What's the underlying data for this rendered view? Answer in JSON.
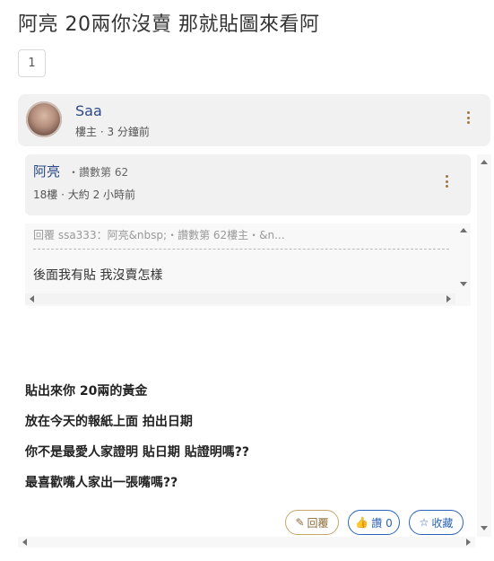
{
  "thread": {
    "title": "阿亮 20兩你沒賣 那就貼圖來看阿",
    "page": "1"
  },
  "op": {
    "name": "Saa",
    "role": "樓主",
    "time": "3 分鐘前"
  },
  "reply": {
    "name": "阿亮",
    "sub": "・讚數第 62",
    "floor": "18樓",
    "time": "大約 2 小時前",
    "quote_ref": "回覆 ssa333：阿亮&nbsp;・讚數第 62樓主・&n...",
    "quote_body": "後面我有貼 我沒賣怎樣",
    "body": [
      "貼出來你 20兩的黃金",
      "放在今天的報紙上面 拍出日期",
      "你不是最愛人家證明 貼日期 貼證明嗎??",
      "最喜歡嘴人家出一張嘴嗎??"
    ]
  },
  "actions": {
    "reply_label": "回覆",
    "like_label": "讚 0",
    "fav_label": "收藏"
  },
  "icons": {
    "reply": "pencil-icon",
    "like": "thumbs-up-icon",
    "fav": "star-icon"
  },
  "colors": {
    "link": "#2b4a8b",
    "accent_blue": "#2b63b8",
    "accent_gold": "#a0783e"
  }
}
